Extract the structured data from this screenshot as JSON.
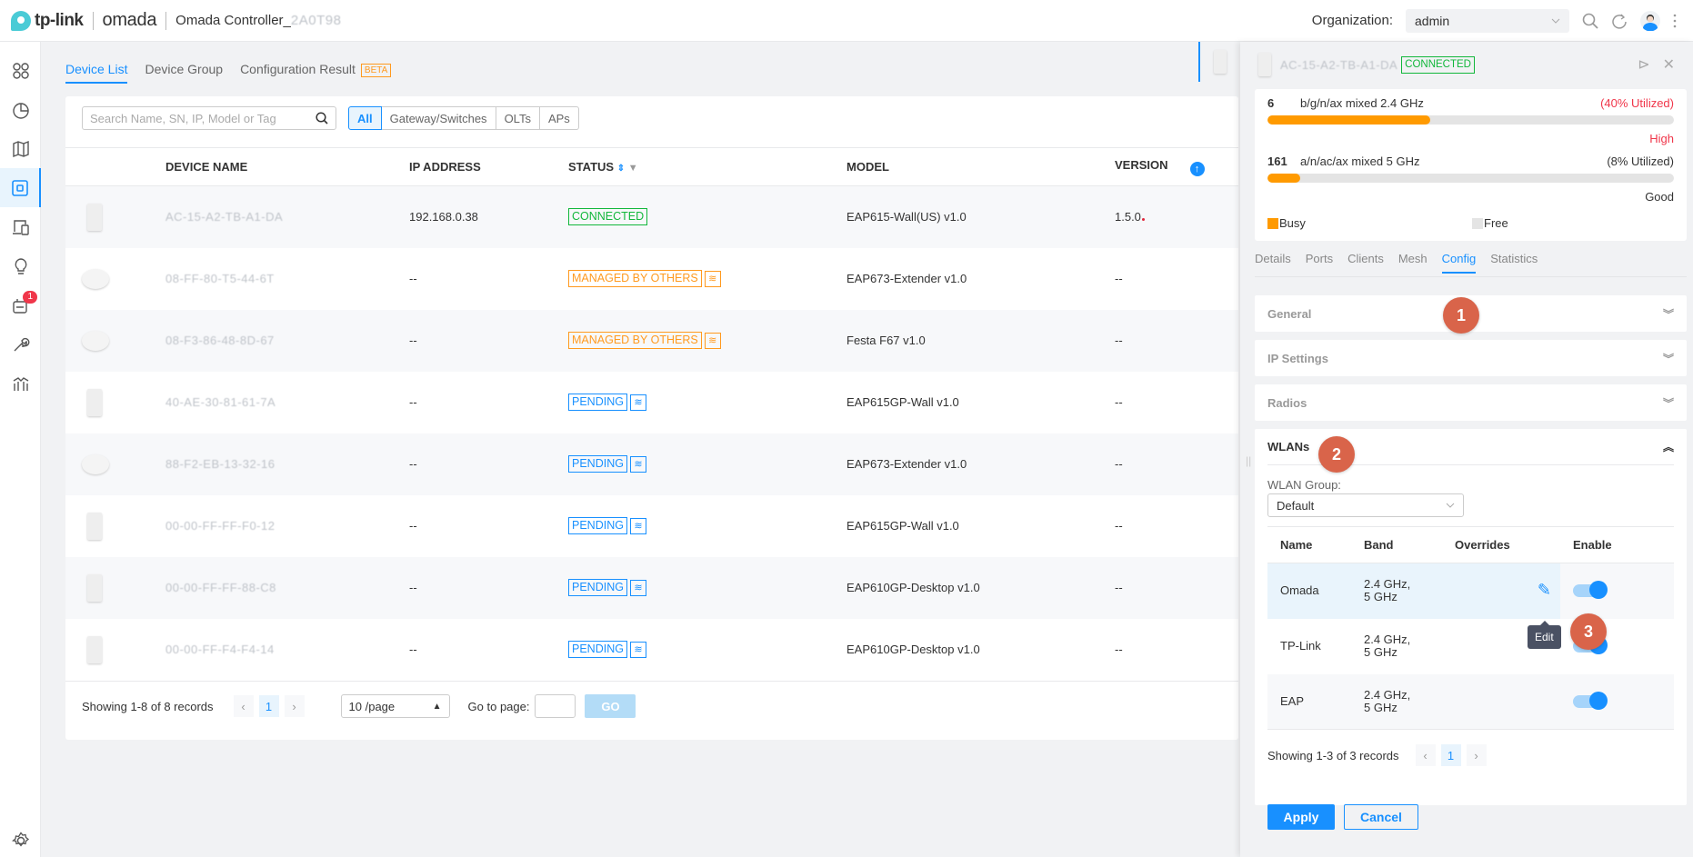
{
  "header": {
    "brand": "tp-link",
    "product": "omada",
    "controller_title": "Omada Controller_",
    "controller_suffix_blurred": "2A0T98",
    "organization_label": "Organization:",
    "organization_value": "admin",
    "icons": [
      "search-icon",
      "refresh-icon",
      "avatar",
      "more-icon"
    ]
  },
  "sidebar": {
    "items": [
      {
        "icon": "dashboard-icon",
        "active": false
      },
      {
        "icon": "statistics-icon",
        "active": false
      },
      {
        "icon": "map-icon",
        "active": false
      },
      {
        "icon": "devices-icon",
        "active": true
      },
      {
        "icon": "clients-icon",
        "active": false
      },
      {
        "icon": "insight-icon",
        "active": false
      },
      {
        "icon": "logs-icon",
        "active": false,
        "badge": "1"
      },
      {
        "icon": "tools-icon",
        "active": false
      },
      {
        "icon": "reports-icon",
        "active": false
      }
    ],
    "settings_icon": "gear-icon"
  },
  "main": {
    "tabs": [
      {
        "label": "Device List",
        "active": true
      },
      {
        "label": "Device Group",
        "active": false
      },
      {
        "label": "Configuration Result",
        "active": false,
        "badge": "BETA"
      }
    ],
    "search_placeholder": "Search Name, SN, IP, Model or Tag",
    "filters": [
      "All",
      "Gateway/Switches",
      "OLTs",
      "APs"
    ],
    "active_filter": "All",
    "columns": [
      "DEVICE NAME",
      "IP ADDRESS",
      "STATUS",
      "MODEL",
      "VERSION"
    ],
    "rows": [
      {
        "name": "AC-15-A2-TB-A1-DA",
        "ip": "192.168.0.38",
        "status": "CONNECTED",
        "status_type": "g",
        "wifi": false,
        "model": "EAP615-Wall(US) v1.0",
        "version": "1.5.0",
        "image": "wall"
      },
      {
        "name": "08-FF-80-T5-44-6T",
        "ip": "--",
        "status": "MANAGED BY OTHERS",
        "status_type": "o",
        "wifi": true,
        "model": "EAP673-Extender v1.0",
        "version": "--",
        "image": "round"
      },
      {
        "name": "08-F3-86-48-8D-67",
        "ip": "--",
        "status": "MANAGED BY OTHERS",
        "status_type": "o",
        "wifi": true,
        "model": "Festa F67 v1.0",
        "version": "--",
        "image": "round"
      },
      {
        "name": "40-AE-30-81-61-7A",
        "ip": "--",
        "status": "PENDING",
        "status_type": "b",
        "wifi": true,
        "model": "EAP615GP-Wall v1.0",
        "version": "--",
        "image": "wall"
      },
      {
        "name": "88-F2-EB-13-32-16",
        "ip": "--",
        "status": "PENDING",
        "status_type": "b",
        "wifi": true,
        "model": "EAP673-Extender v1.0",
        "version": "--",
        "image": "round"
      },
      {
        "name": "00-00-FF-FF-F0-12",
        "ip": "--",
        "status": "PENDING",
        "status_type": "b",
        "wifi": true,
        "model": "EAP615GP-Wall v1.0",
        "version": "--",
        "image": "wall"
      },
      {
        "name": "00-00-FF-FF-88-C8",
        "ip": "--",
        "status": "PENDING",
        "status_type": "b",
        "wifi": true,
        "model": "EAP610GP-Desktop v1.0",
        "version": "--",
        "image": "desk"
      },
      {
        "name": "00-00-FF-F4-F4-14",
        "ip": "--",
        "status": "PENDING",
        "status_type": "b",
        "wifi": true,
        "model": "EAP610GP-Desktop v1.0",
        "version": "--",
        "image": "desk"
      }
    ],
    "pagination": {
      "summary": "Showing 1-8 of 8 records",
      "current_page": "1",
      "page_size": "10 /page",
      "goto_label": "Go to page:",
      "goto_value": "",
      "go_label": "GO"
    }
  },
  "panel": {
    "device_name": "AC-15-A2-TB-A1-DA",
    "device_status": "CONNECTED",
    "radios": [
      {
        "channel": "6",
        "mode": "b/g/n/ax mixed  2.4 GHz",
        "utilization_text": "(40% Utilized)",
        "utilization_pct": 40,
        "level": "High",
        "level_color": "#f0364a"
      },
      {
        "channel": "161",
        "mode": "a/n/ac/ax mixed  5 GHz",
        "utilization_text": "(8% Utilized)",
        "utilization_pct": 8,
        "level": "Good",
        "level_color": "#333333"
      }
    ],
    "legend": {
      "busy": "Busy",
      "free": "Free",
      "busy_color": "#ff9a00",
      "free_color": "#e4e4e4"
    },
    "tabs": [
      "Details",
      "Ports",
      "Clients",
      "Mesh",
      "Config",
      "Statistics"
    ],
    "active_tab": "Config",
    "sections": [
      "General",
      "IP Settings",
      "Radios"
    ],
    "wlans": {
      "title": "WLANs",
      "group_label": "WLAN Group:",
      "group_value": "Default",
      "columns": [
        "Name",
        "Band",
        "Overrides",
        "Enable"
      ],
      "rows": [
        {
          "name": "Omada",
          "band_line1": "2.4 GHz,",
          "band_line2": "5 GHz",
          "enabled": true
        },
        {
          "name": "TP-Link",
          "band_line1": "2.4 GHz,",
          "band_line2": "5 GHz",
          "enabled": true
        },
        {
          "name": "EAP",
          "band_line1": "2.4 GHz,",
          "band_line2": "5 GHz",
          "enabled": true
        }
      ],
      "tooltip": "Edit",
      "summary": "Showing 1-3 of 3 records",
      "current_page": "1"
    },
    "apply_label": "Apply",
    "cancel_label": "Cancel"
  },
  "annotations": [
    "1",
    "2",
    "3"
  ],
  "colors": {
    "accent": "#1890ff",
    "connected": "#12b73b",
    "managed": "#ff9a1f",
    "step": "#d9644a"
  }
}
